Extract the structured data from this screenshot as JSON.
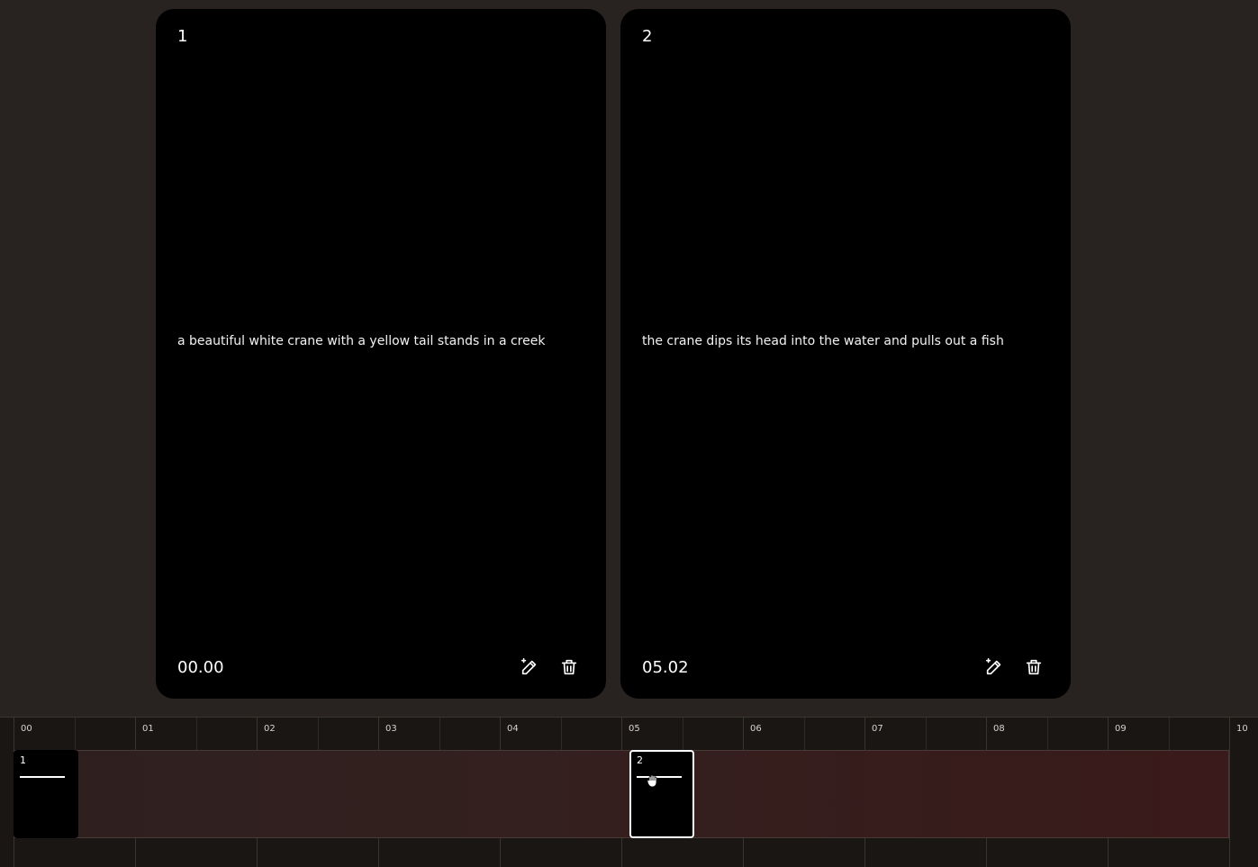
{
  "cards": [
    {
      "index": "1",
      "prompt": "a beautiful white crane with a yellow tail stands in a creek",
      "time": "00.00"
    },
    {
      "index": "2",
      "prompt": "the crane dips its head into the water and pulls out a fish",
      "time": "05.02"
    }
  ],
  "timeline": {
    "ticks": [
      "00",
      "01",
      "02",
      "03",
      "04",
      "05",
      "06",
      "07",
      "08",
      "09",
      "10"
    ],
    "clips": [
      {
        "index": "1"
      },
      {
        "index": "2"
      }
    ]
  },
  "icons": {
    "edit": "magic-pencil-icon",
    "delete": "trash-icon",
    "cursor": "grab-hand-icon"
  },
  "colors": {
    "background": "#282320",
    "card": "#000000",
    "text": "#ffffff",
    "track": "#3a1a1a"
  }
}
